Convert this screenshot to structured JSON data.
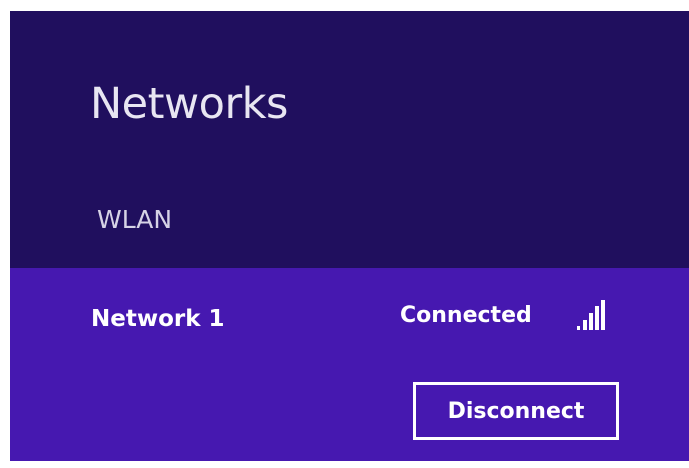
{
  "panel": {
    "title": "Networks",
    "section_label": "WLAN"
  },
  "networks": [
    {
      "name": "Network 1",
      "status": "Connected",
      "signal_icon": "signal-strength-full-icon",
      "action_label": "Disconnect"
    }
  ],
  "colors": {
    "panel_background": "#200f5e",
    "selected_item_background": "#4618b0",
    "text": "#ffffff"
  }
}
